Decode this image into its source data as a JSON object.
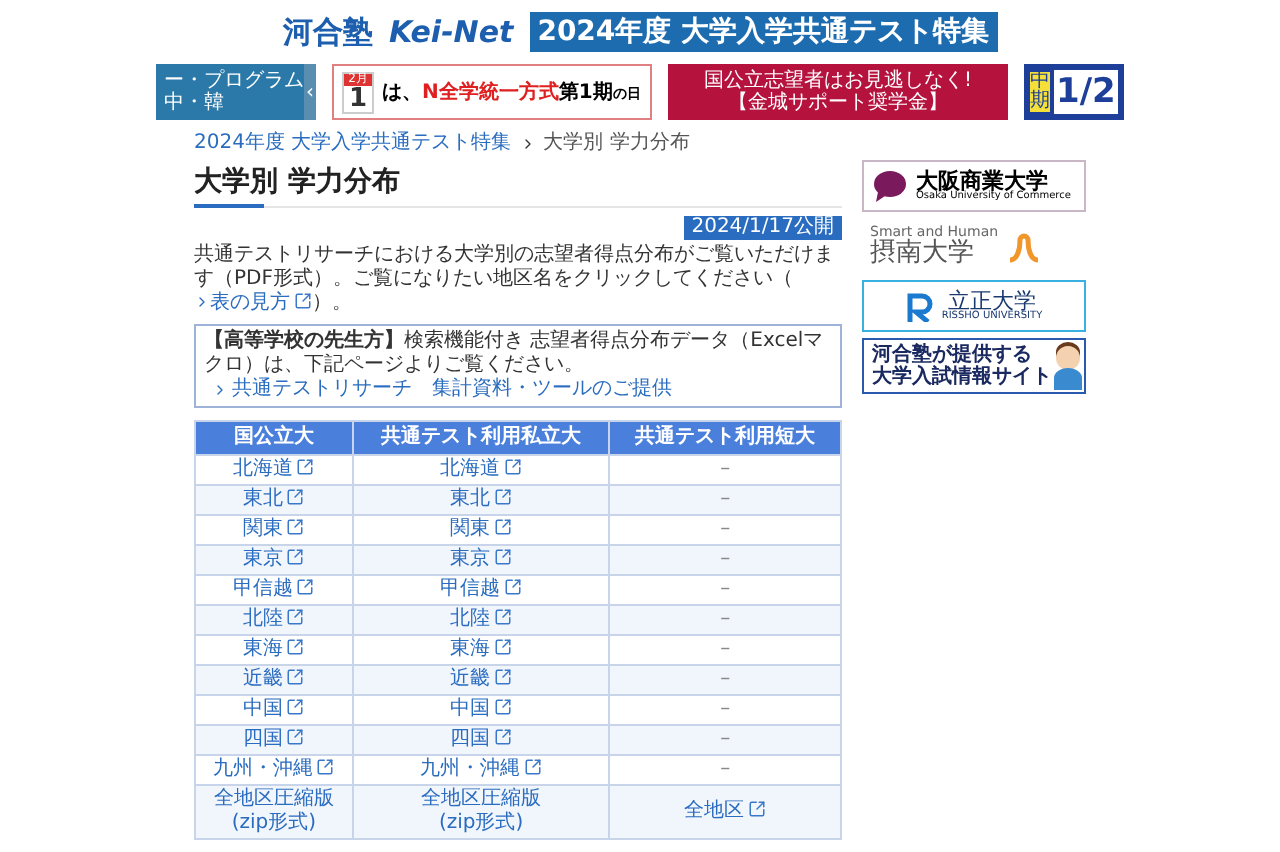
{
  "header": {
    "logo_main": "河合塾",
    "logo_net": "Kei-Net",
    "feature_title": "2024年度 大学入学共通テスト特集"
  },
  "banners": {
    "program": {
      "lines": [
        "ー・プログラム",
        "中・韓"
      ],
      "arrow": "‹"
    },
    "calendar": {
      "month": "2月",
      "day": "1",
      "text_before": "は、",
      "highlight": "N全学統一方式",
      "text_bold": "第1期",
      "text_after": "の日"
    },
    "scholarship": {
      "line1": "国公立志望者はお見逃しなく!",
      "line2": "【金城サポート奨学金】"
    },
    "exam": {
      "label": "中期",
      "date": "1/2"
    }
  },
  "breadcrumb": [
    {
      "label": "2024年度 大学入学共通テスト特集",
      "link": true
    },
    {
      "label": "大学別 学力分布",
      "link": false
    }
  ],
  "page_title": "大学別 学力分布",
  "published": "2024/1/17公開",
  "intro": {
    "before": "共通テストリサーチにおける大学別の志望者得点分布がご覧いただけます（PDF形式）。ご覧になりたい地区名をクリックしてください（",
    "link": "表の見方",
    "after": "）。"
  },
  "notice": {
    "text": "**【高等学校の先生方】**検索機能付き 志望者得点分布データ（Excelマクロ）は、下記ページよりご覧ください。",
    "link": "共通テストリサーチ　集計資料・ツールのご提供"
  },
  "table": {
    "columns": [
      "国公立大",
      "共通テスト利用私立大",
      "共通テスト利用短大"
    ],
    "rows": [
      [
        {
          "kind": "link",
          "text": "北海道"
        },
        {
          "kind": "link",
          "text": "北海道"
        },
        {
          "kind": "dash",
          "text": "–"
        }
      ],
      [
        {
          "kind": "link",
          "text": "東北"
        },
        {
          "kind": "link",
          "text": "東北"
        },
        {
          "kind": "dash",
          "text": "–"
        }
      ],
      [
        {
          "kind": "link",
          "text": "関東"
        },
        {
          "kind": "link",
          "text": "関東"
        },
        {
          "kind": "dash",
          "text": "–"
        }
      ],
      [
        {
          "kind": "link",
          "text": "東京"
        },
        {
          "kind": "link",
          "text": "東京"
        },
        {
          "kind": "dash",
          "text": "–"
        }
      ],
      [
        {
          "kind": "link",
          "text": "甲信越"
        },
        {
          "kind": "link",
          "text": "甲信越"
        },
        {
          "kind": "dash",
          "text": "–"
        }
      ],
      [
        {
          "kind": "link",
          "text": "北陸"
        },
        {
          "kind": "link",
          "text": "北陸"
        },
        {
          "kind": "dash",
          "text": "–"
        }
      ],
      [
        {
          "kind": "link",
          "text": "東海"
        },
        {
          "kind": "link",
          "text": "東海"
        },
        {
          "kind": "dash",
          "text": "–"
        }
      ],
      [
        {
          "kind": "link",
          "text": "近畿"
        },
        {
          "kind": "link",
          "text": "近畿"
        },
        {
          "kind": "dash",
          "text": "–"
        }
      ],
      [
        {
          "kind": "link",
          "text": "中国"
        },
        {
          "kind": "link",
          "text": "中国"
        },
        {
          "kind": "dash",
          "text": "–"
        }
      ],
      [
        {
          "kind": "link",
          "text": "四国"
        },
        {
          "kind": "link",
          "text": "四国"
        },
        {
          "kind": "dash",
          "text": "–"
        }
      ],
      [
        {
          "kind": "link",
          "text": "九州・沖縄"
        },
        {
          "kind": "link",
          "text": "九州・沖縄"
        },
        {
          "kind": "dash",
          "text": "–"
        }
      ],
      [
        {
          "kind": "zip",
          "text": "全地区圧縮版",
          "sub": "(zip形式)"
        },
        {
          "kind": "zip",
          "text": "全地区圧縮版",
          "sub": "(zip形式)"
        },
        {
          "kind": "link",
          "text": "全地区"
        }
      ]
    ]
  },
  "sidebar_ads": [
    {
      "kind": "osaka",
      "title": "大阪商業大学",
      "sub": "Osaka University of Commerce"
    },
    {
      "kind": "setsunan",
      "sub": "Smart and Human",
      "title": "摂南大学"
    },
    {
      "kind": "rissho",
      "title": "立正大学",
      "sub": "RISSHO UNIVERSITY"
    },
    {
      "kind": "kawai",
      "lines": [
        "河合塾が提供する",
        "大学入試情報サイト"
      ]
    }
  ]
}
